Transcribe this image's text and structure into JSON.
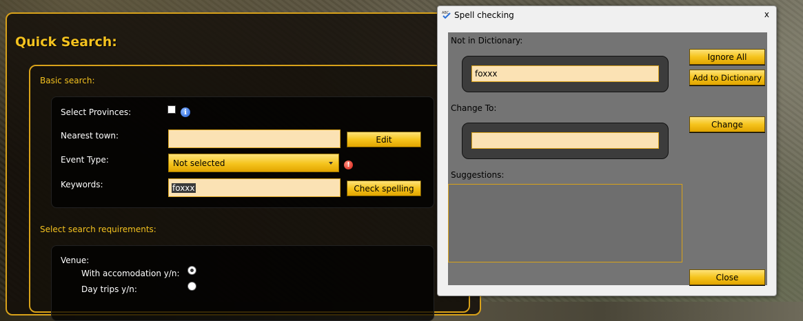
{
  "quick_search": {
    "title": "Quick Search:",
    "basic_search_label": "Basic search:",
    "select_provinces_label": "Select Provinces:",
    "nearest_town_label": "Nearest town:",
    "nearest_town_value": "",
    "edit_button": "Edit",
    "event_type_label": "Event Type:",
    "event_type_value": "Not selected",
    "keywords_label": "Keywords:",
    "keywords_value": "foxxx",
    "check_spelling_button": "Check spelling",
    "requirements_label": "Select search requirements:",
    "venue_label": "Venue:",
    "with_accomodation_label": "With accomodation y/n:",
    "day_trips_label": "Day trips y/n:",
    "with_accomodation_checked": true,
    "day_trips_checked": false
  },
  "spell_dialog": {
    "title": "Spell checking",
    "close_glyph": "x",
    "not_in_dictionary_label": "Not in Dictionary:",
    "not_in_dictionary_value": "foxxx",
    "change_to_label": "Change To:",
    "change_to_value": "",
    "suggestions_label": "Suggestions:",
    "ignore_all_button": "Ignore All",
    "add_to_dictionary_button": "Add to Dictionary",
    "change_button": "Change",
    "close_button": "Close"
  },
  "colors": {
    "accent_gold": "#f4c21f",
    "input_fill": "#fbe2b4",
    "dialog_body": "#747474"
  }
}
